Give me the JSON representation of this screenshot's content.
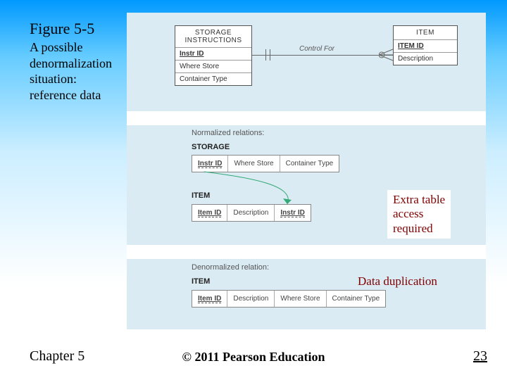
{
  "figure": {
    "title": "Figure 5-5",
    "subtitle_l1": "A possible",
    "subtitle_l2": "denormalization",
    "subtitle_l3": "situation:",
    "subtitle_l4": "reference data"
  },
  "er": {
    "storage": {
      "name": "STORAGE",
      "name2": "INSTRUCTIONS",
      "pk": "Instr ID",
      "a1": "Where Store",
      "a2": "Container Type"
    },
    "item": {
      "name": "ITEM",
      "pk": "ITEM ID",
      "a1": "Description"
    },
    "rel": "Control For"
  },
  "norm": {
    "heading": "Normalized relations:",
    "storage_name": "STORAGE",
    "storage": {
      "c1": "Instr ID",
      "c2": "Where Store",
      "c3": "Container Type"
    },
    "item_name": "ITEM",
    "item": {
      "c1": "Item ID",
      "c2": "Description",
      "c3": "Instr ID"
    }
  },
  "denorm": {
    "heading": "Denormalized relation:",
    "item_name": "ITEM",
    "item": {
      "c1": "Item ID",
      "c2": "Description",
      "c3": "Where Store",
      "c4": "Container Type"
    }
  },
  "annot": {
    "extra_l1": "Extra table",
    "extra_l2": "access",
    "extra_l3": "required",
    "dup": "Data duplication"
  },
  "footer": {
    "chapter": "Chapter 5",
    "copyright": "© 2011 Pearson Education",
    "page": "23"
  }
}
